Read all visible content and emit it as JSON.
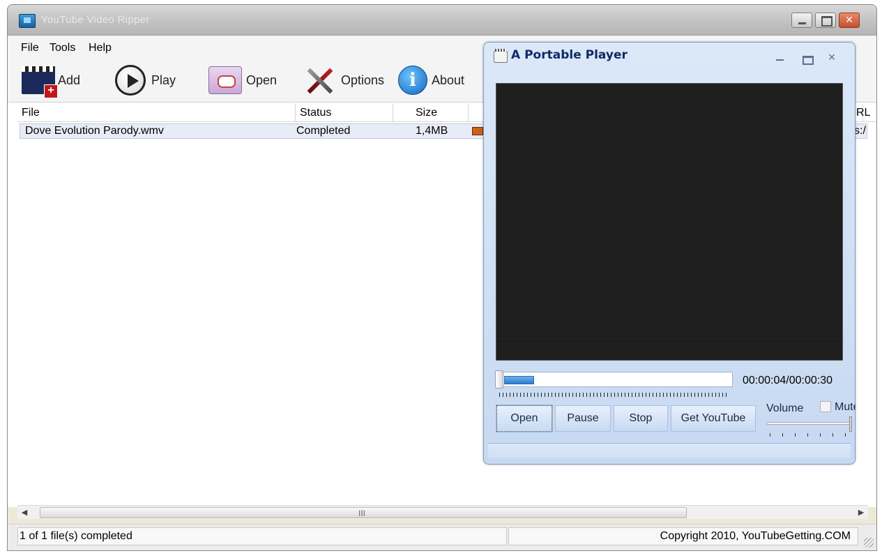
{
  "app": {
    "title": "YouTube Video Ripper"
  },
  "menu": {
    "items": [
      "File",
      "Tools",
      "Help"
    ]
  },
  "toolbar": {
    "add_label": "Add",
    "play_label": "Play",
    "open_label": "Open",
    "options_label": "Options",
    "about_label": "About",
    "about_icon_glyph": "i"
  },
  "list": {
    "columns": [
      "File",
      "Status",
      "Size",
      "",
      "RL"
    ],
    "rows": [
      {
        "file": "Dove Evolution Parody.wmv",
        "status": "Completed",
        "size": "1,4MB",
        "url": "s:/"
      }
    ]
  },
  "scrollbar": {
    "left_arrow": "◀",
    "right_arrow": "▶",
    "grip": "III"
  },
  "statusbar": {
    "left_text": "1 of 1 file(s) completed",
    "right_text": "Copyright 2010, YouTubeGetting.COM"
  },
  "player": {
    "title": "A Portable Player",
    "close_glyph": "×",
    "time": "00:00:04/00:00:30",
    "progress": 0.133,
    "buttons": {
      "open": "Open",
      "pause": "Pause",
      "stop": "Stop",
      "get_youtube": "Get YouTube"
    },
    "volume_label": "Volume",
    "mute_label": "Mute",
    "volume_level": 1.0
  },
  "colors": {
    "player_title": "#102a66",
    "progress_fill": "#2c7ccc",
    "download_bar": "#d06018"
  }
}
